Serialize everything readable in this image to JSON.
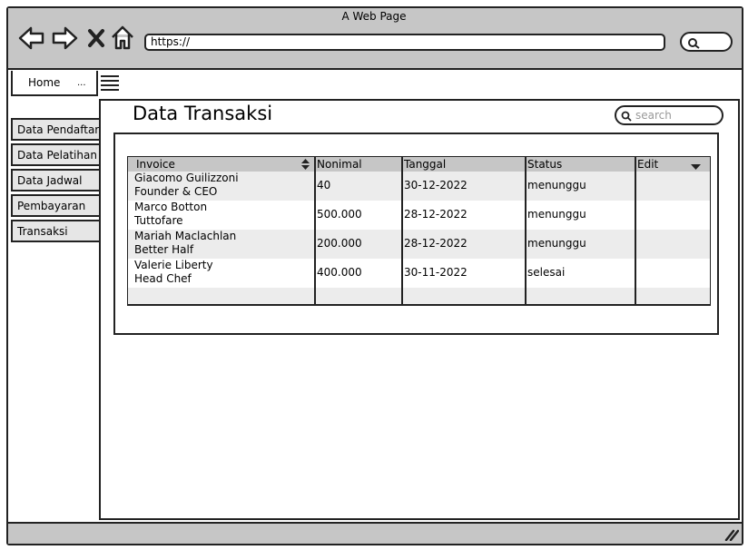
{
  "browser": {
    "title": "A Web Page",
    "url": "https://"
  },
  "tabs": {
    "home": "Home",
    "more": "..."
  },
  "sidebar": {
    "items": [
      {
        "label": "Data Pendaftar"
      },
      {
        "label": "Data Pelatihan"
      },
      {
        "label": "Data Jadwal"
      },
      {
        "label": "Pembayaran"
      },
      {
        "label": "Transaksi"
      }
    ]
  },
  "page": {
    "title": "Data Transaksi",
    "search_placeholder": "search"
  },
  "table": {
    "columns": [
      "Invoice",
      "Nonimal",
      "Tanggal",
      "Status",
      "Edit"
    ],
    "rows": [
      {
        "invoice_name": "Giacomo Guilizzoni",
        "invoice_sub": "Founder & CEO",
        "nominal": "40",
        "tanggal": "30-12-2022",
        "status": "menunggu"
      },
      {
        "invoice_name": "Marco Botton",
        "invoice_sub": "Tuttofare",
        "nominal": "500.000",
        "tanggal": "28-12-2022",
        "status": "menunggu"
      },
      {
        "invoice_name": "Mariah Maclachlan",
        "invoice_sub": "Better Half",
        "nominal": "200.000",
        "tanggal": "28-12-2022",
        "status": "menunggu"
      },
      {
        "invoice_name": "Valerie Liberty",
        "invoice_sub": "Head Chef",
        "nominal": "400.000",
        "tanggal": "30-11-2022",
        "status": "selesai"
      }
    ]
  },
  "icons": {
    "back": "back-arrow-icon",
    "forward": "forward-arrow-icon",
    "close": "close-icon",
    "home": "home-icon",
    "search": "search-icon",
    "menu": "hamburger-menu-icon",
    "sort": "sort-icon",
    "dropdown": "chevron-down-icon",
    "resize": "resize-grip-icon"
  }
}
